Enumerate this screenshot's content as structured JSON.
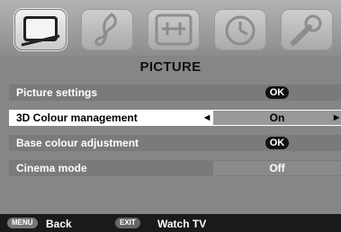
{
  "tabs": [
    {
      "icon": "picture-icon",
      "active": true
    },
    {
      "icon": "music-note-icon",
      "active": false
    },
    {
      "icon": "settings-panel-icon",
      "active": false
    },
    {
      "icon": "clock-icon",
      "active": false
    },
    {
      "icon": "wrench-icon",
      "active": false
    }
  ],
  "menu": {
    "title": "PICTURE",
    "rows": [
      {
        "label": "Picture settings",
        "value": "OK"
      },
      {
        "label": "3D Colour management",
        "value": "On"
      },
      {
        "label": "Base colour adjustment",
        "value": "OK"
      },
      {
        "label": "Cinema mode",
        "value": "Off"
      }
    ]
  },
  "footer": {
    "menu_key": "MENU",
    "back_label": "Back",
    "exit_key": "EXIT",
    "watch_label": "Watch TV"
  }
}
